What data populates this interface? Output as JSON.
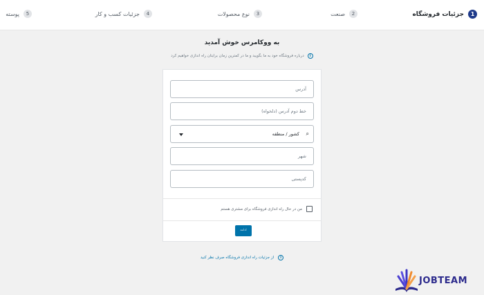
{
  "stepper": {
    "steps": [
      {
        "num": "1",
        "label": "جزئیات فروشگاه"
      },
      {
        "num": "2",
        "label": "صنعت"
      },
      {
        "num": "3",
        "label": "نوع محصولات"
      },
      {
        "num": "4",
        "label": "جزئیات کسب و کار"
      },
      {
        "num": "5",
        "label": "پوسته"
      }
    ],
    "active_color": "#1e3a8a"
  },
  "header": {
    "title": "به ووکامرس خوش آمدید",
    "subtitle": "درباره فروشگاه خود به ما بگویید و ما در کمترین زمان برایتان راه اندازی خواهیم کرد",
    "info_icon": "info-icon"
  },
  "form": {
    "address_placeholder": "آدرس",
    "address2_placeholder": "خط دوم آدرس (دلخواه)",
    "country_label": "کشور / منطقه",
    "city_placeholder": "شهر",
    "postcode_placeholder": "کدپستی",
    "checkbox_label": "من در حال راه اندازی فروشگاه برای مشتری هستم",
    "continue_label": "ادامه",
    "accent_color": "#0073aa"
  },
  "footer": {
    "skip_label": "از جزئیات راه اندازی فروشگاه صرف نظر کنید"
  },
  "watermark": {
    "text": "JOBTEAM"
  }
}
